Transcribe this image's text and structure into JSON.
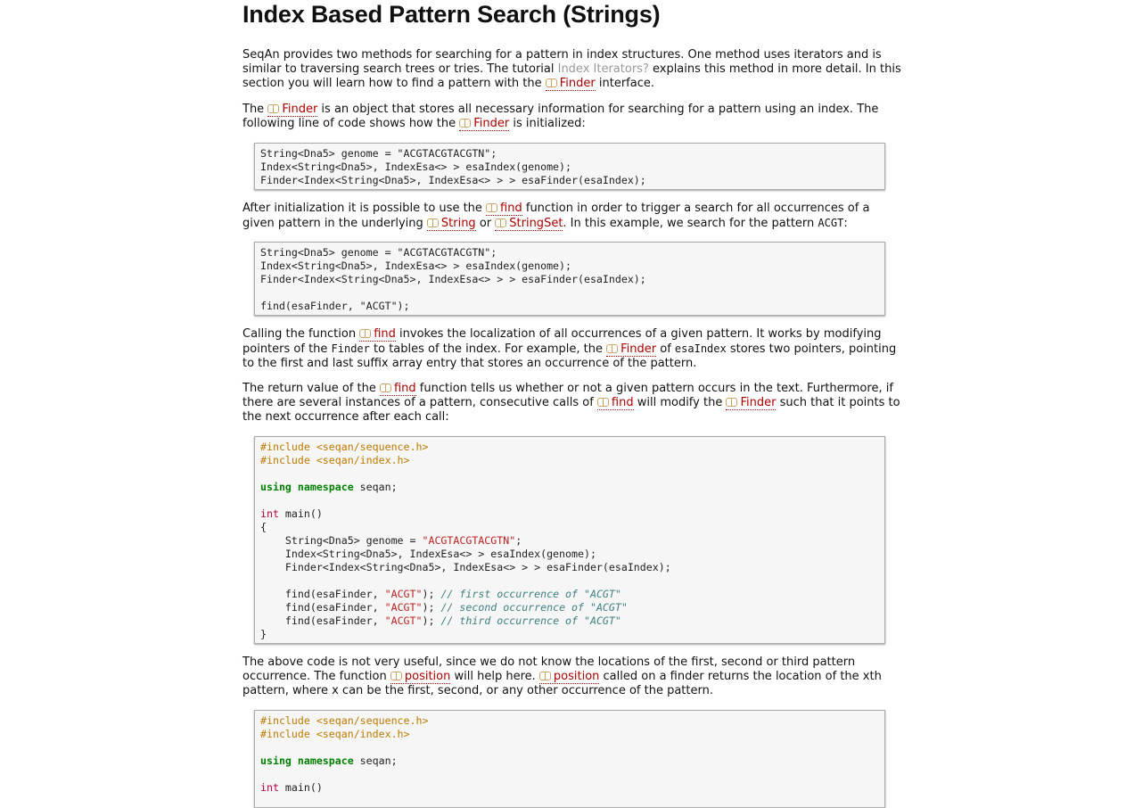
{
  "title": "Index Based Pattern Search (Strings)",
  "p1": {
    "t1": "SeqAn provides two methods for searching for a pattern in index structures. One method uses iterators and is similar to traversing search trees or tries. The tutorial ",
    "link_iter": "Index Iterators?",
    "t2": " explains this method in more detail. In this section you will learn how to find a pattern with the ",
    "link_finder": "Finder",
    "t3": " interface."
  },
  "p2": {
    "t1": "The ",
    "link_finder": "Finder",
    "t2": " is an object that stores all necessary information for searching for a pattern using an index. The following line of code shows how the ",
    "t3": " is initialized:"
  },
  "code1": [
    "String<Dna5> genome = \"ACGTACGTACGTN\";",
    "Index<String<Dna5>, IndexEsa<> > esaIndex(genome);",
    "Finder<Index<String<Dna5>, IndexEsa<> > > esaFinder(esaIndex);"
  ],
  "p3": {
    "t1": "After initialization it is possible to use the ",
    "link_find": "find",
    "t2": " function in order to trigger a search for all occurrences of a given pattern in the underlying ",
    "link_string": "String",
    "t3": " or ",
    "link_stringset": "StringSet",
    "t4": ". In this example, we search for the pattern ",
    "code_acgt": "ACGT",
    "t5": ":"
  },
  "code2": [
    "String<Dna5> genome = \"ACGTACGTACGTN\";",
    "Index<String<Dna5>, IndexEsa<> > esaIndex(genome);",
    "Finder<Index<String<Dna5>, IndexEsa<> > > esaFinder(esaIndex);",
    "",
    "find(esaFinder, \"ACGT\");"
  ],
  "p4": {
    "t1": "Calling the function ",
    "link_find": "find",
    "t2": " invokes the localization of all occurrences of a given pattern. It works by modifying pointers of the ",
    "code_finder": "Finder",
    "t3": " to tables of the index. For example, the ",
    "link_finder": "Finder",
    "t4": " of ",
    "code_esaindex": "esaIndex",
    "t5": " stores two pointers, pointing to the first and last suffix array entry that stores an occurrence of the pattern."
  },
  "p5": {
    "t1": "The return value of the ",
    "link_find": "find",
    "t2": " function tells us whether or not a given pattern occurs in the text. Furthermore, if there are several instances of a pattern, consecutive calls of ",
    "t3": " will modify the ",
    "link_finder": "Finder",
    "t4": " such that it points to the next occurrence after each call:"
  },
  "code3": {
    "inc1": "#include <seqan/sequence.h>",
    "inc2": "#include <seqan/index.h>",
    "using_kw": "using namespace",
    "using_rest": " seqan;",
    "int_kw": "int",
    "main_rest": " main()",
    "open": "{",
    "l1a": "    String<Dna5> genome = ",
    "l1s": "\"ACGTACGTACGTN\"",
    "l1b": ";",
    "l2": "    Index<String<Dna5>, IndexEsa<> > esaIndex(genome);",
    "l3": "    Finder<Index<String<Dna5>, IndexEsa<> > > esaFinder(esaIndex);",
    "f_pre": "    find(esaFinder, ",
    "f_str": "\"ACGT\"",
    "f_post": "); ",
    "c1": "// first occurrence of \"ACGT\"",
    "c2": "// second occurrence of \"ACGT\"",
    "c3": "// third occurrence of \"ACGT\"",
    "close": "}"
  },
  "p6": {
    "t1": "The above code is not very useful, since we do not know the locations of the first, second or third pattern occurrence. The function ",
    "link_position": "position",
    "t2": " will help here. ",
    "t3": " called on a finder returns the location of the xth pattern, where x can be the first, second, or any other occurrence of the pattern."
  },
  "code4": {
    "inc1": "#include <seqan/sequence.h>",
    "inc2": "#include <seqan/index.h>",
    "using_kw": "using namespace",
    "using_rest": " seqan;",
    "int_kw": "int",
    "main_rest": " main()"
  }
}
